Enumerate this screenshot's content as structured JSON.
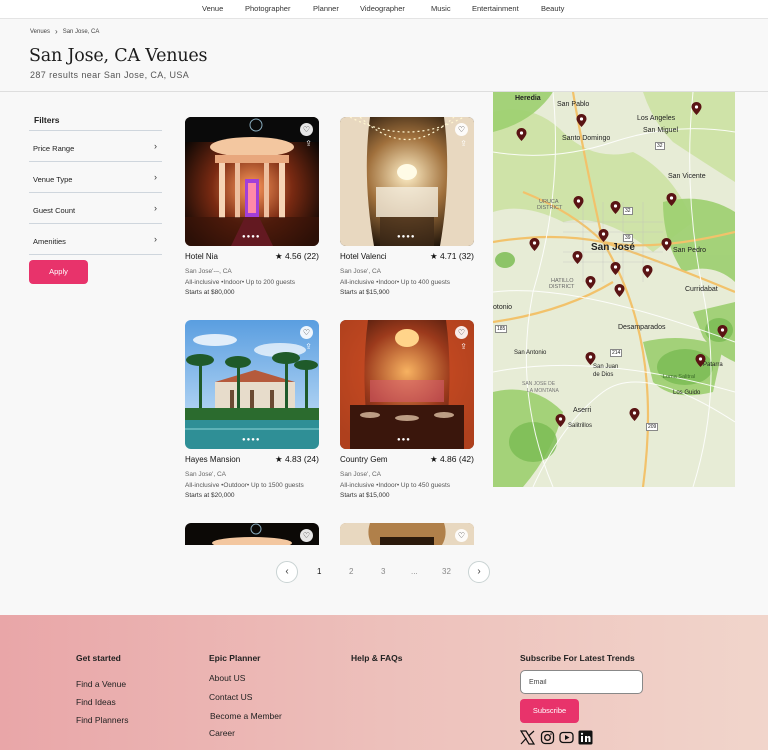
{
  "topnav": {
    "items": [
      "Venue",
      "Photographer",
      "Planner",
      "Videographer",
      "Music",
      "Entertainment",
      "Beauty"
    ]
  },
  "breadcrumb": {
    "root": "Venues",
    "current": "San Jose, CA"
  },
  "header": {
    "title": "San  Jose, CA Venues",
    "subtitle": "287 results near San Jose, CA, USA"
  },
  "filters": {
    "title": "Filters",
    "items": [
      "Price Range",
      "Venue Type",
      "Guest Count",
      "Amenities"
    ],
    "apply_label": "Apply"
  },
  "venues": [
    {
      "name": "Hotel Nia",
      "rating": "4.56",
      "reviews": "(22)",
      "location": "San Jose'-–, CA",
      "meta": "All-inclusive •Indoor• Up to 200 guests",
      "price": "Starts at $80,000"
    },
    {
      "name": "Hotel Valenci",
      "rating": "4.71",
      "reviews": "(32)",
      "location": "San Jose', CA",
      "meta": "All-inclusive •Indoor• Up to 400 guests",
      "price": "Starts at $15,900"
    },
    {
      "name": "Hayes Mansion",
      "rating": "4.83",
      "reviews": "(24)",
      "location": "San Jose', CA",
      "meta": "All-inclusive •Outdoor• Up to 1500 guests",
      "price": "Starts at $20,000"
    },
    {
      "name": "Country Gem",
      "rating": "4.86",
      "reviews": "(42)",
      "location": "San Jose', CA",
      "meta": "All-inclusive •Indoor• Up to 450 guests",
      "price": "Starts at $15,000"
    }
  ],
  "map": {
    "labels": [
      "Heredia",
      "San Pablo",
      "Los Angeles",
      "San Miguel",
      "Santo Domingo",
      "San Vicente",
      "URUCA",
      "DISTRICT",
      "San José",
      "San Pedro",
      "HATILLO",
      "DISTRICT",
      "Curridabat",
      "otonio",
      "Desamparados",
      "San Antonio",
      "San Juan",
      "de Dios",
      "Patarra",
      "Loma Salitral",
      "Los Guido",
      "Aserri",
      "Salitrillos",
      "SAN JOSE DE",
      "LA MONTANA"
    ],
    "route_numbers": [
      "32",
      "32",
      "39",
      "185",
      "214",
      "209"
    ]
  },
  "pagination": {
    "prev_icon": "chevron-left-icon",
    "pages": [
      "1",
      "2",
      "3",
      "...",
      "32"
    ],
    "current": "1",
    "next_icon": "chevron-right-icon"
  },
  "footer": {
    "col1": {
      "title": "Get started",
      "links": [
        "Find a Venue",
        "Find Ideas",
        "Find Planners"
      ]
    },
    "col2": {
      "title": "Epic Planner",
      "links": [
        "About US",
        "Contact US",
        "Become a Member",
        "Career"
      ]
    },
    "col3": {
      "title": "Help & FAQs"
    },
    "subscribe": {
      "title": "Subscribe For Latest Trends",
      "placeholder": "Email",
      "button": "Subscribe"
    },
    "social": [
      "x-icon",
      "instagram-icon",
      "youtube-icon",
      "linkedin-icon"
    ]
  },
  "colors": {
    "accent": "#e8336b",
    "footer_start": "#e9a6a8",
    "footer_end": "#f1d5cb",
    "pin": "#5a1414"
  }
}
